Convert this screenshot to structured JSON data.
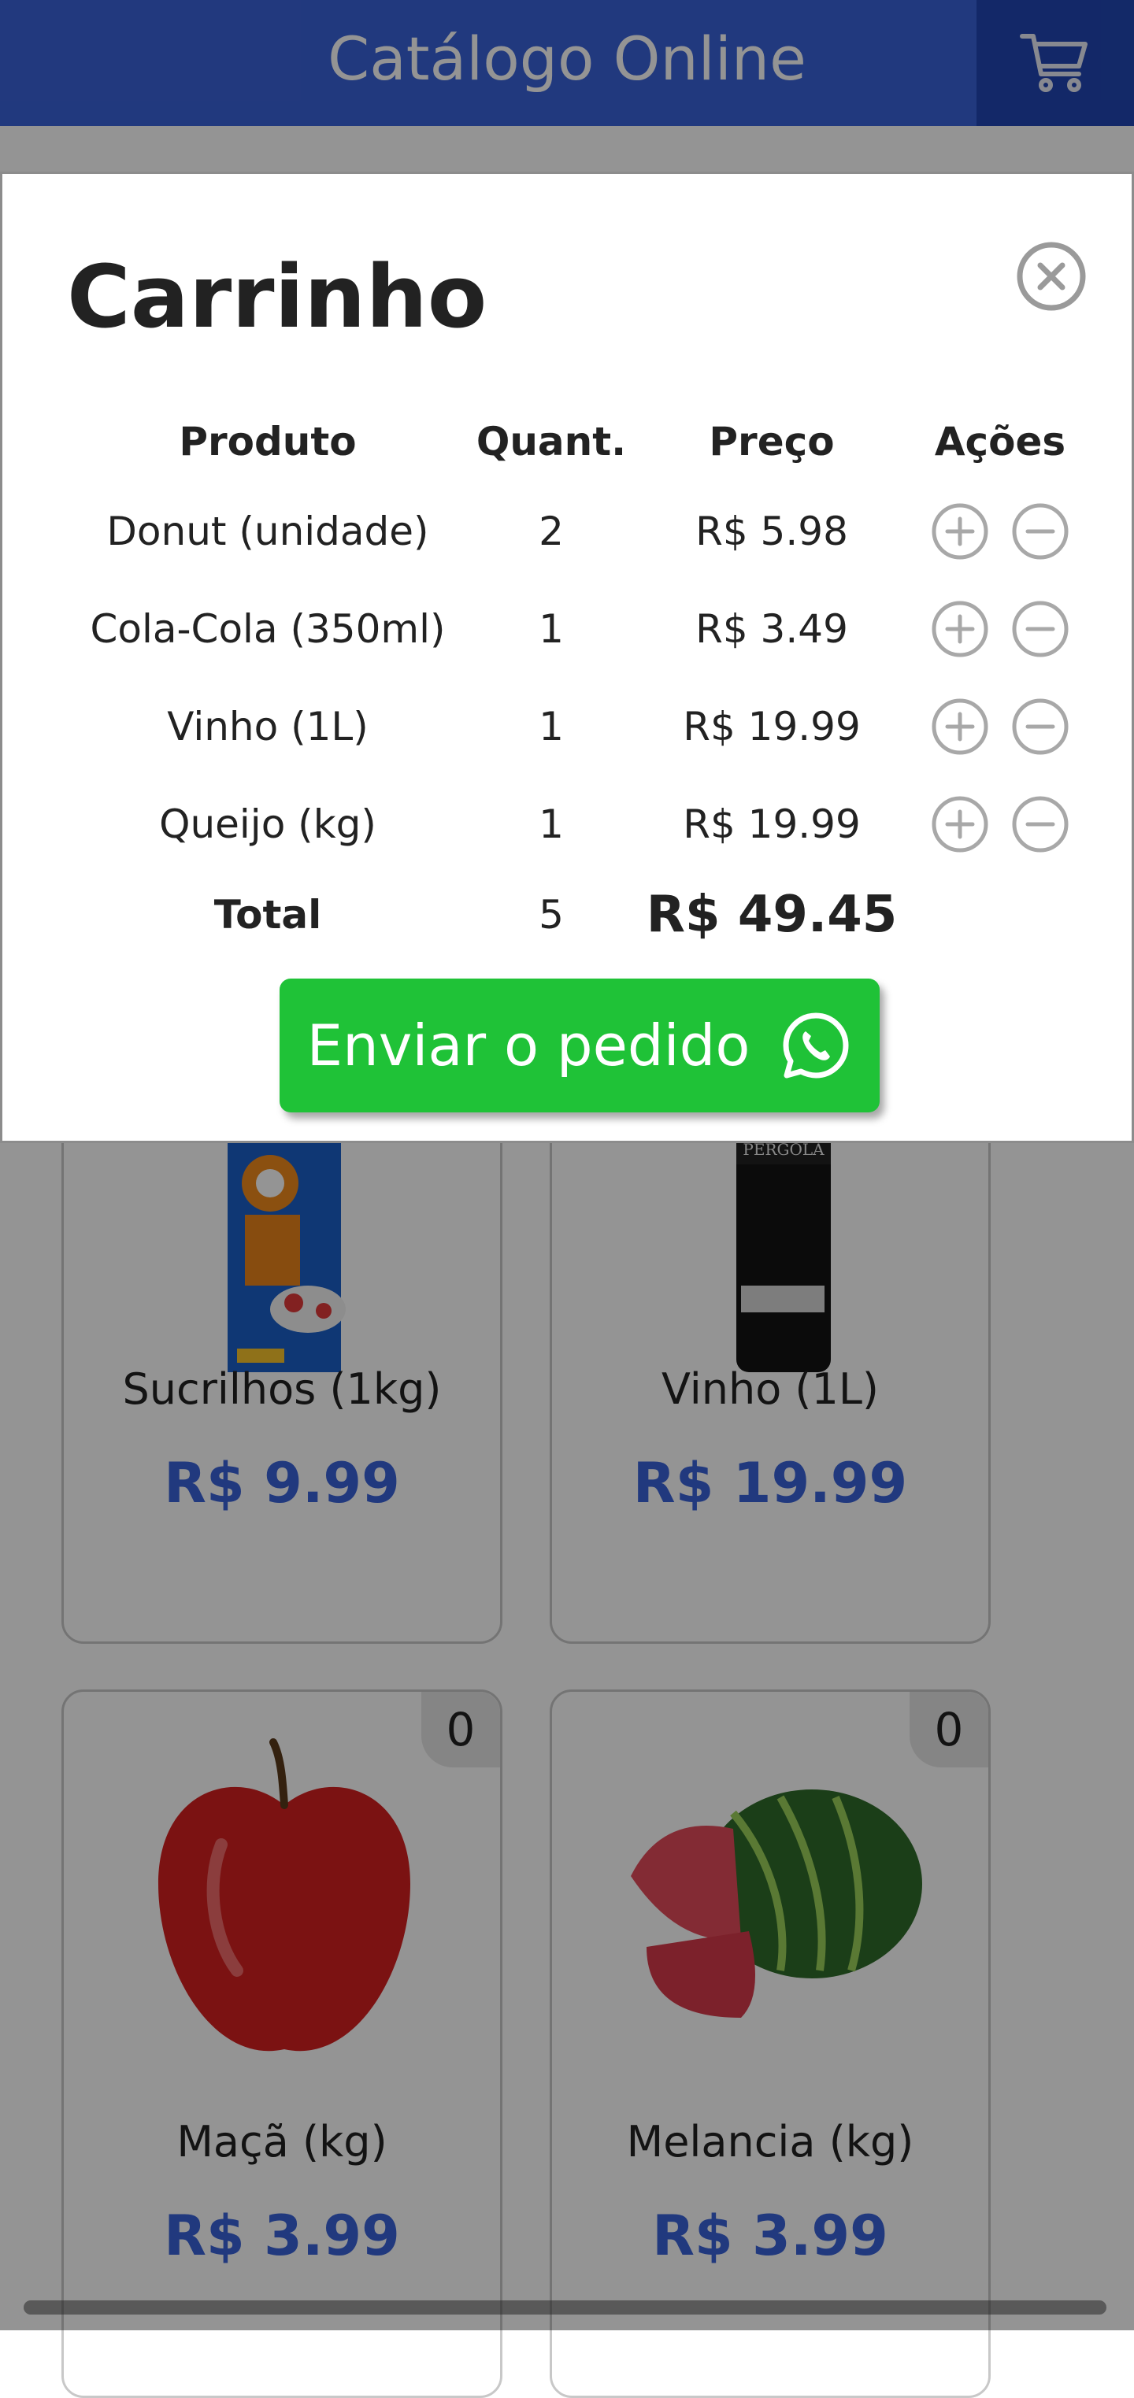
{
  "header": {
    "title": "Catálogo Online"
  },
  "products": [
    {
      "name": "Sucrilhos (1kg)",
      "price": "R$ 9.99",
      "image": "cereal-box"
    },
    {
      "name": "Vinho (1L)",
      "price": "R$ 19.99",
      "image": "wine-bottle"
    },
    {
      "name": "Maçã (kg)",
      "price": "R$ 3.99",
      "badge": "0",
      "image": "apple"
    },
    {
      "name": "Melancia (kg)",
      "price": "R$ 3.99",
      "badge": "0",
      "image": "watermelon"
    }
  ],
  "cart": {
    "title": "Carrinho",
    "columns": [
      "Produto",
      "Quant.",
      "Preço",
      "Ações"
    ],
    "rows": [
      {
        "product": "Donut (unidade)",
        "qty": "2",
        "price": "R$ 5.98"
      },
      {
        "product": "Cola-Cola (350ml)",
        "qty": "1",
        "price": "R$ 3.49"
      },
      {
        "product": "Vinho (1L)",
        "qty": "1",
        "price": "R$ 19.99"
      },
      {
        "product": "Queijo (kg)",
        "qty": "1",
        "price": "R$ 19.99"
      }
    ],
    "total": {
      "label": "Total",
      "qty": "5",
      "price": "R$ 49.45"
    },
    "send_label": "Enviar o pedido"
  },
  "icons": {
    "cart": "shopping-cart-icon",
    "close": "close-icon",
    "add": "plus-circle-icon",
    "remove": "minus-circle-icon",
    "whatsapp": "whatsapp-icon"
  },
  "colors": {
    "header": "#3a63d9",
    "cart_button": "#2146b4",
    "price": "#3a63d9",
    "send_button": "#1fc237"
  }
}
